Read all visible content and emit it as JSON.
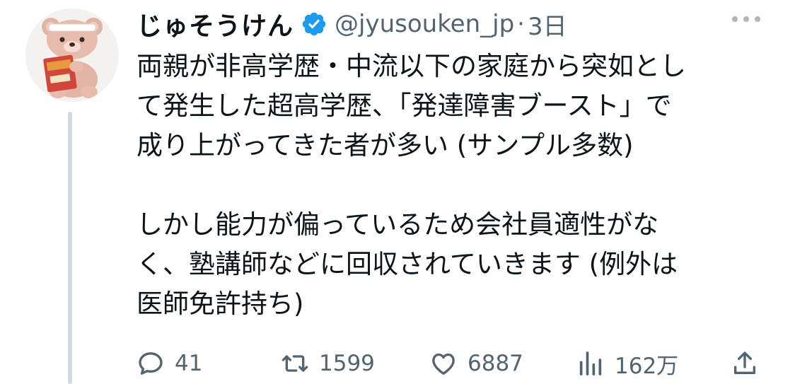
{
  "user": {
    "display_name": "じゅそうけん",
    "handle": "@jyusouken_jp",
    "separator": "·",
    "time": "3日",
    "verified": true
  },
  "tweet": {
    "paragraphs": [
      [
        "両親が非高学歴・中流以下の家庭から突如とし",
        "て発生した超高学歴、「発達障害ブースト」で",
        "成り上がってきた者が多い (サンプル多数)"
      ],
      [
        "しかし能力が偏っているため会社員適性がな",
        "く、塾講師などに回収されていきます (例外は",
        "医師免許持ち)"
      ]
    ]
  },
  "actions": {
    "reply": {
      "icon": "reply-icon",
      "count": "41"
    },
    "retweet": {
      "icon": "retweet-icon",
      "count": "1599"
    },
    "like": {
      "icon": "heart-icon",
      "count": "6887"
    },
    "views": {
      "icon": "views-icon",
      "count": "162万"
    },
    "share": {
      "icon": "share-icon"
    }
  },
  "colors": {
    "text": "#0f1419",
    "muted": "#536471",
    "verified": "#1d9bf0",
    "thread_line": "#cfd9de"
  }
}
